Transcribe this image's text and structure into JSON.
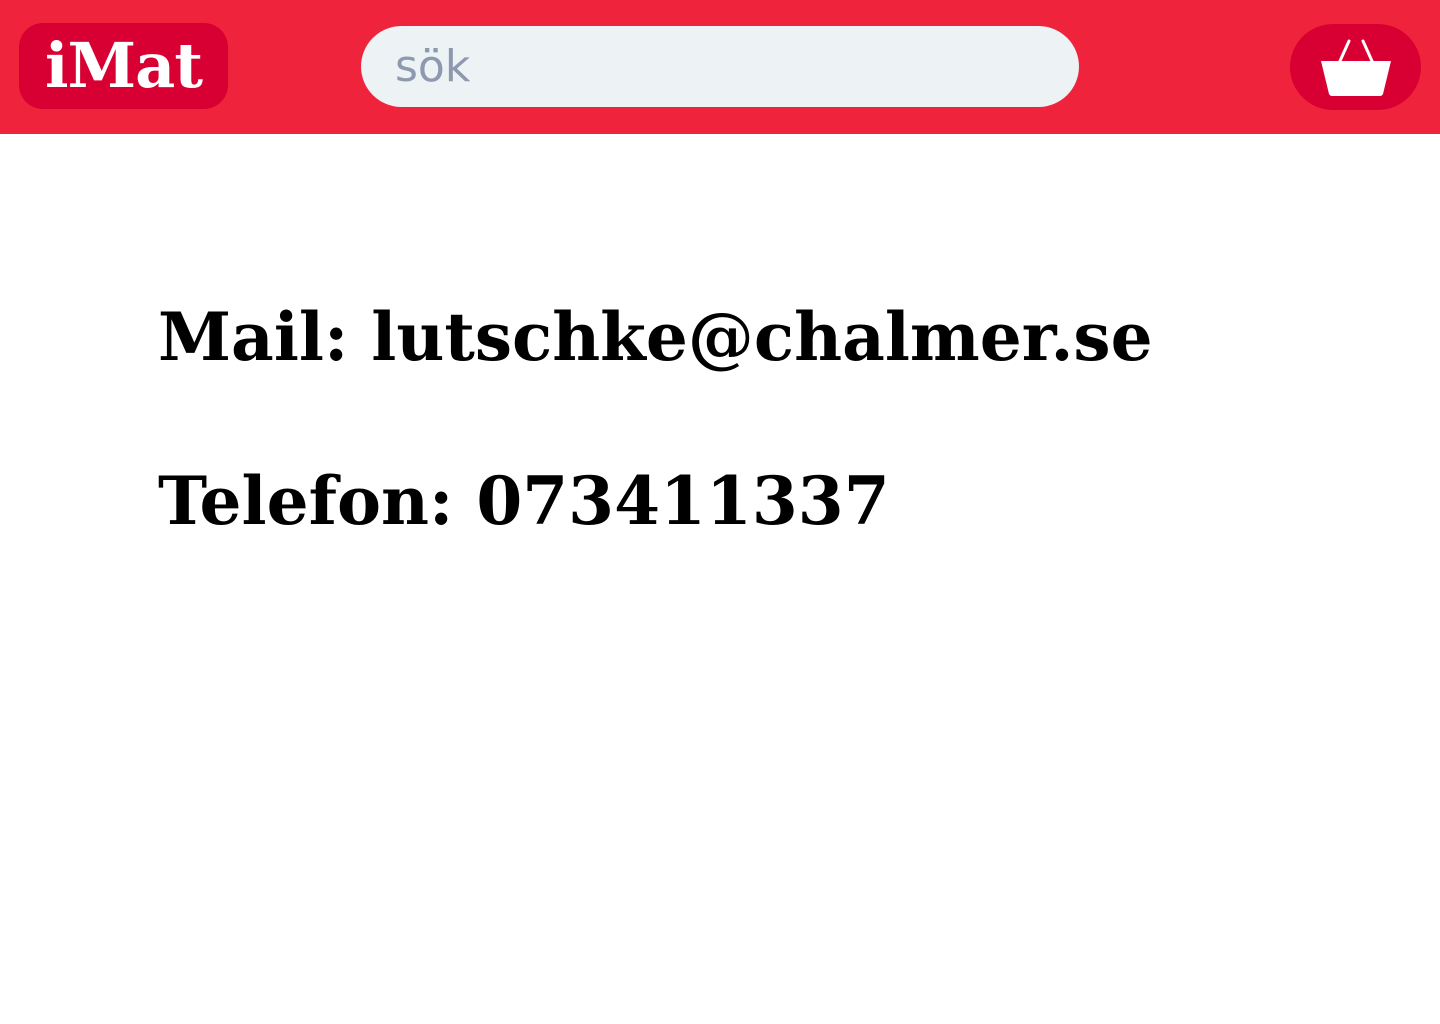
{
  "header": {
    "logo_text": "iMat",
    "search": {
      "placeholder": "sök",
      "value": ""
    },
    "cart_icon": "basket-icon"
  },
  "contact": {
    "mail_line": "Mail: lutschke@chalmer.se",
    "phone_line": "Telefon: 073411337"
  },
  "colors": {
    "header_bg": "#EF233C",
    "accent_dark": "#D80032",
    "search_bg": "#EDF2F4",
    "placeholder": "#8D99AE",
    "text": "#000000"
  }
}
